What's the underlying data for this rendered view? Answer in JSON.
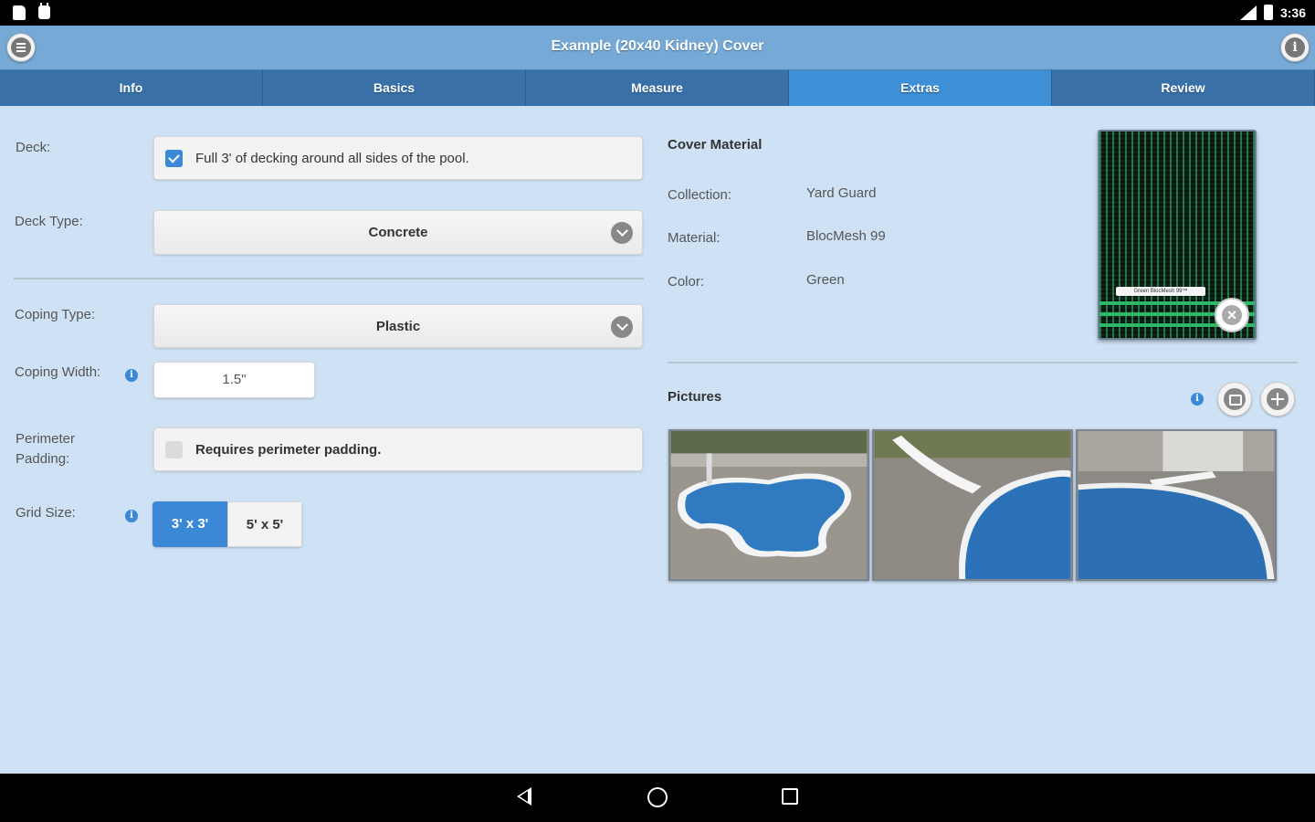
{
  "status_bar": {
    "time": "3:36"
  },
  "app": {
    "title": "Example (20x40 Kidney) Cover"
  },
  "tabs": [
    {
      "label": "Info"
    },
    {
      "label": "Basics"
    },
    {
      "label": "Measure"
    },
    {
      "label": "Extras",
      "active": true
    },
    {
      "label": "Review"
    }
  ],
  "form": {
    "deck": {
      "label": "Deck:",
      "checkbox_label": "Full 3' of decking around all sides of the pool.",
      "checked": true
    },
    "deck_type": {
      "label": "Deck Type:",
      "value": "Concrete"
    },
    "coping_type": {
      "label": "Coping Type:",
      "value": "Plastic"
    },
    "coping_width": {
      "label": "Coping Width:",
      "value": "1.5\""
    },
    "perimeter_padding": {
      "label": "Perimeter Padding:",
      "checkbox_label": "Requires perimeter padding.",
      "checked": false
    },
    "grid_size": {
      "label": "Grid Size:",
      "options": [
        "3' x 3'",
        "5' x 5'"
      ],
      "selected": "3' x 3'"
    }
  },
  "cover_material": {
    "heading": "Cover Material",
    "collection_label": "Collection:",
    "collection": "Yard Guard",
    "material_label": "Material:",
    "material": "BlocMesh 99",
    "color_label": "Color:",
    "color": "Green",
    "swatch_tag": "Green BlocMesh 99™"
  },
  "pictures": {
    "heading": "Pictures"
  },
  "colors": {
    "accent": "#3a88d6",
    "tabbar": "#3a70a8",
    "header": "#76a9d5",
    "background": "#cfe2f5",
    "swatch_green": "#2fb86a"
  }
}
